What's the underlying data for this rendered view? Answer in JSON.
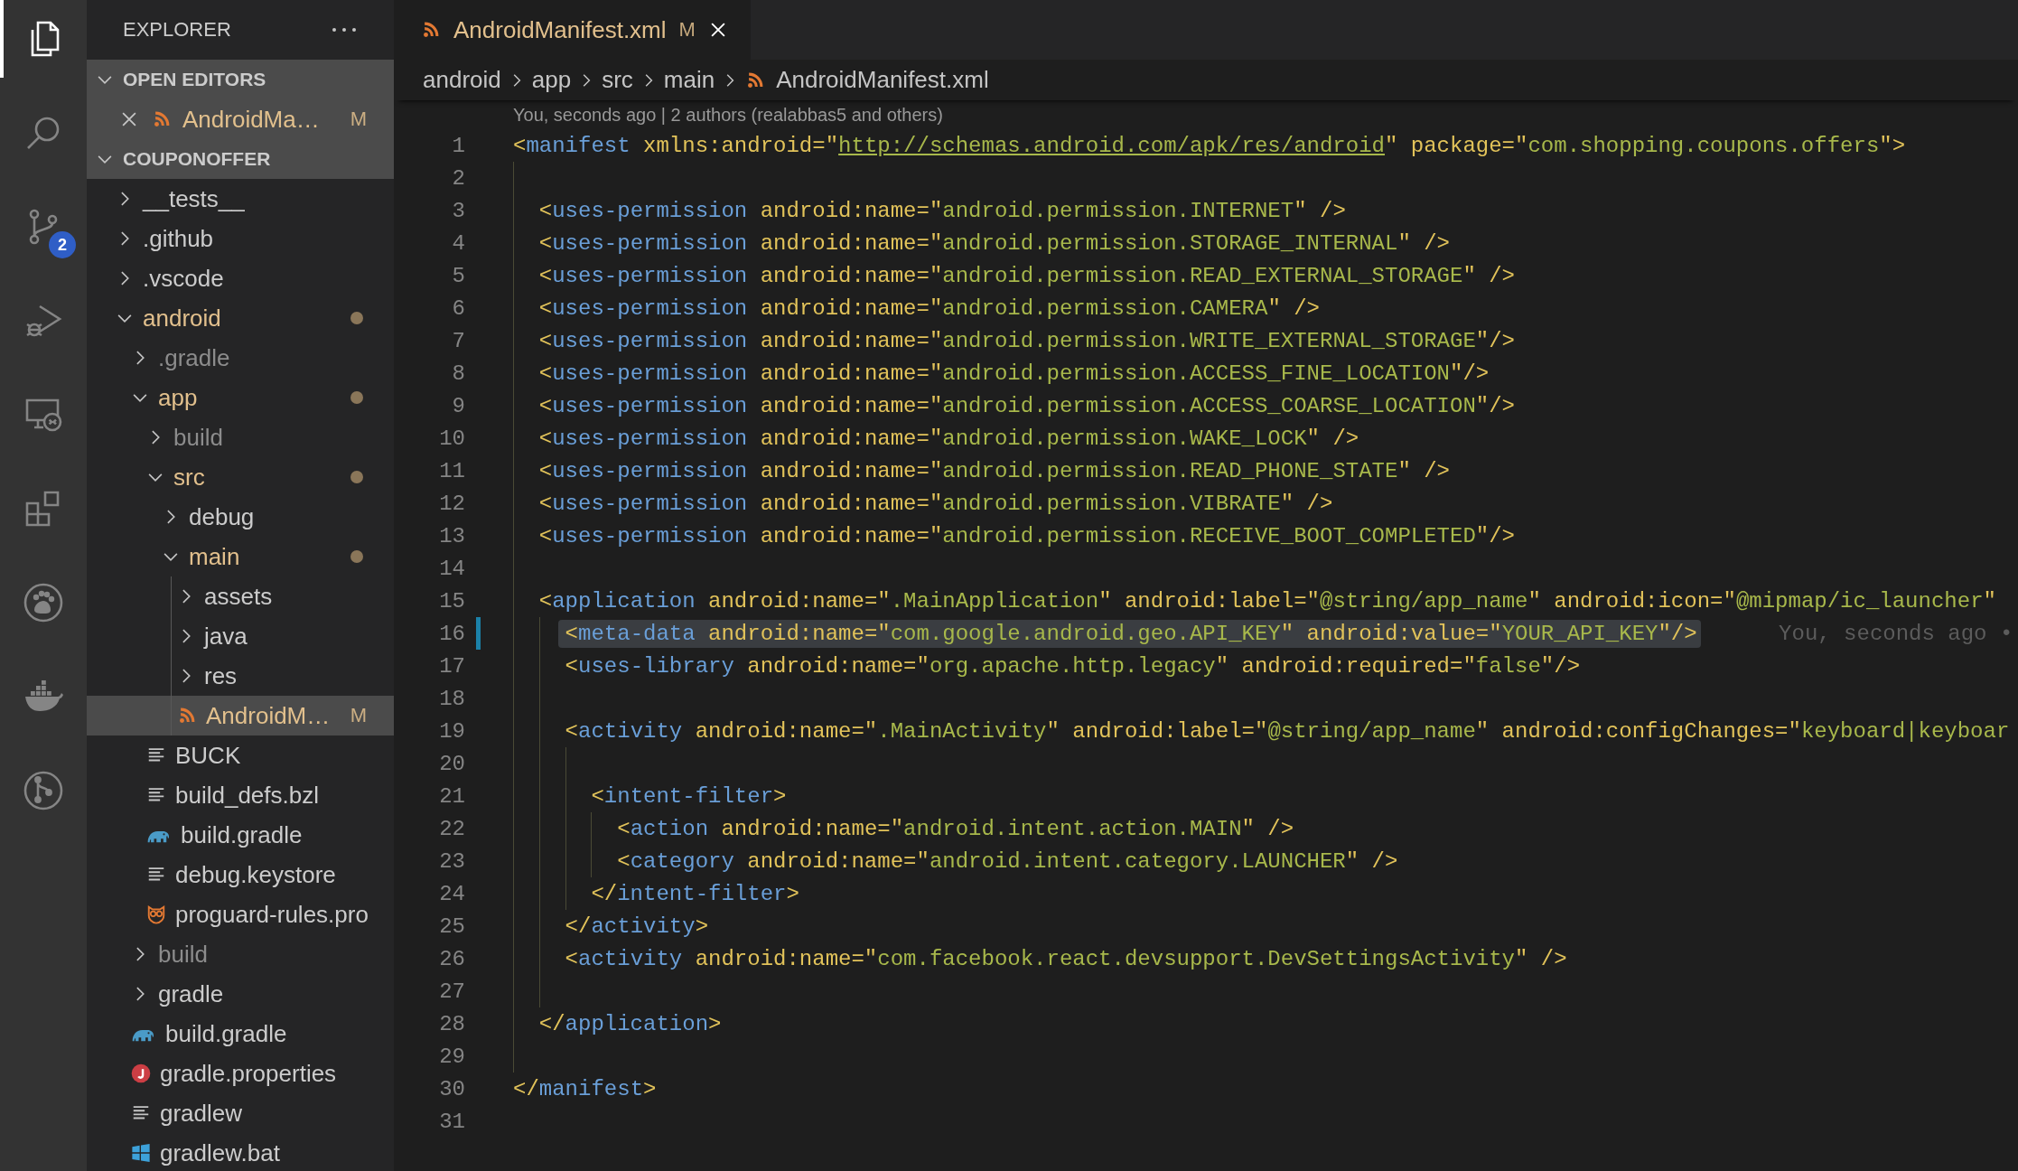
{
  "activity_bar": [
    {
      "kind": "files",
      "selected": true
    },
    {
      "kind": "search",
      "selected": false
    },
    {
      "kind": "source-control",
      "selected": false,
      "badge": "2"
    },
    {
      "kind": "run-debug",
      "selected": false
    },
    {
      "kind": "remote",
      "selected": false
    },
    {
      "kind": "extensions",
      "selected": false
    },
    {
      "kind": "paw",
      "selected": false
    },
    {
      "kind": "whale",
      "selected": false
    },
    {
      "kind": "git-graph",
      "selected": false
    }
  ],
  "sidebar": {
    "title": "EXPLORER",
    "open_editors": {
      "title": "OPEN EDITORS",
      "expanded": true,
      "items": [
        {
          "name": "AndroidMa…",
          "kind": "rss-file",
          "modified": true,
          "badge": "M"
        }
      ]
    },
    "project": {
      "title": "COUPONOFFER",
      "expanded": true,
      "tree": [
        {
          "name": "__tests__",
          "kind": "folder",
          "expanded": false,
          "modified": false,
          "ignored": false,
          "selected": false
        },
        {
          "name": ".github",
          "kind": "folder",
          "expanded": false,
          "modified": false,
          "ignored": false,
          "selected": false
        },
        {
          "name": ".vscode",
          "kind": "folder",
          "expanded": false,
          "modified": false,
          "ignored": false,
          "selected": false
        },
        {
          "name": "android",
          "kind": "folder",
          "expanded": true,
          "modified": true,
          "ignored": false,
          "selected": false,
          "children": [
            {
              "name": ".gradle",
              "kind": "folder",
              "expanded": false,
              "modified": false,
              "ignored": true,
              "selected": false
            },
            {
              "name": "app",
              "kind": "folder",
              "expanded": true,
              "modified": true,
              "ignored": false,
              "selected": false,
              "children": [
                {
                  "name": "build",
                  "kind": "folder",
                  "expanded": false,
                  "modified": false,
                  "ignored": true,
                  "selected": false
                },
                {
                  "name": "src",
                  "kind": "folder",
                  "expanded": true,
                  "modified": true,
                  "ignored": false,
                  "selected": false,
                  "children": [
                    {
                      "name": "debug",
                      "kind": "folder",
                      "expanded": false,
                      "modified": false,
                      "ignored": false,
                      "selected": false
                    },
                    {
                      "name": "main",
                      "kind": "folder",
                      "expanded": true,
                      "modified": true,
                      "ignored": false,
                      "selected": false,
                      "children": [
                        {
                          "name": "assets",
                          "kind": "folder",
                          "expanded": false,
                          "modified": false,
                          "ignored": false,
                          "selected": false
                        },
                        {
                          "name": "java",
                          "kind": "folder",
                          "expanded": false,
                          "modified": false,
                          "ignored": false,
                          "selected": false
                        },
                        {
                          "name": "res",
                          "kind": "folder",
                          "expanded": false,
                          "modified": false,
                          "ignored": false,
                          "selected": false
                        },
                        {
                          "name": "AndroidM…",
                          "kind": "rss-file",
                          "modified": true,
                          "ignored": false,
                          "badge": "M",
                          "selected": true
                        }
                      ]
                    }
                  ]
                },
                {
                  "name": "BUCK",
                  "kind": "text-file",
                  "modified": false,
                  "ignored": false,
                  "selected": false
                },
                {
                  "name": "build_defs.bzl",
                  "kind": "text-file",
                  "modified": false,
                  "ignored": false,
                  "selected": false
                },
                {
                  "name": "build.gradle",
                  "kind": "gradle-file",
                  "modified": false,
                  "ignored": false,
                  "selected": false
                },
                {
                  "name": "debug.keystore",
                  "kind": "text-file",
                  "modified": false,
                  "ignored": false,
                  "selected": false
                },
                {
                  "name": "proguard-rules.pro",
                  "kind": "owl-file",
                  "modified": false,
                  "ignored": false,
                  "selected": false
                }
              ]
            },
            {
              "name": "build",
              "kind": "folder",
              "expanded": false,
              "modified": false,
              "ignored": true,
              "selected": false
            },
            {
              "name": "gradle",
              "kind": "folder",
              "expanded": false,
              "modified": false,
              "ignored": false,
              "selected": false
            },
            {
              "name": "build.gradle",
              "kind": "gradle-file",
              "modified": false,
              "ignored": false,
              "selected": false
            },
            {
              "name": "gradle.properties",
              "kind": "properties-file",
              "modified": false,
              "ignored": false,
              "selected": false
            },
            {
              "name": "gradlew",
              "kind": "text-file",
              "modified": false,
              "ignored": false,
              "selected": false
            },
            {
              "name": "gradlew.bat",
              "kind": "batch-file",
              "modified": false,
              "ignored": false,
              "selected": false
            }
          ]
        }
      ]
    }
  },
  "editor": {
    "tabs": [
      {
        "title": "AndroidManifest.xml",
        "kind": "rss-file",
        "modified": true,
        "badge": "M",
        "selected": true
      }
    ],
    "breadcrumbs": [
      {
        "text": "android",
        "kind": "folder"
      },
      {
        "text": "app",
        "kind": "folder"
      },
      {
        "text": "src",
        "kind": "folder"
      },
      {
        "text": "main",
        "kind": "folder"
      },
      {
        "text": "AndroidManifest.xml",
        "kind": "rss-file"
      }
    ],
    "codelens": "You, seconds ago | 2 authors (realabbas5 and others)",
    "lines": [
      {
        "number": "1",
        "tokens": [
          {
            "kind": "punct",
            "text": "<"
          },
          {
            "kind": "tag",
            "text": "manifest"
          },
          {
            "kind": "attr",
            "text": " xmlns:android"
          },
          {
            "kind": "punct",
            "text": "=\""
          },
          {
            "kind": "link",
            "text": "http://schemas.android.com/apk/res/android"
          },
          {
            "kind": "punct",
            "text": "\""
          },
          {
            "kind": "attr",
            "text": " package"
          },
          {
            "kind": "punct",
            "text": "=\""
          },
          {
            "kind": "string",
            "text": "com.shopping.coupons.offers"
          },
          {
            "kind": "punct",
            "text": "\">"
          }
        ]
      },
      {
        "number": "2"
      },
      {
        "number": "3",
        "tokens": [
          {
            "kind": "punct",
            "text": "  <"
          },
          {
            "kind": "tag",
            "text": "uses-permission"
          },
          {
            "kind": "attr",
            "text": " android:name"
          },
          {
            "kind": "punct",
            "text": "=\""
          },
          {
            "kind": "string",
            "text": "android.permission.INTERNET"
          },
          {
            "kind": "punct",
            "text": "\" />"
          }
        ]
      },
      {
        "number": "4",
        "tokens": [
          {
            "kind": "punct",
            "text": "  <"
          },
          {
            "kind": "tag",
            "text": "uses-permission"
          },
          {
            "kind": "attr",
            "text": " android:name"
          },
          {
            "kind": "punct",
            "text": "=\""
          },
          {
            "kind": "string",
            "text": "android.permission.STORAGE_INTERNAL"
          },
          {
            "kind": "punct",
            "text": "\" />"
          }
        ]
      },
      {
        "number": "5",
        "tokens": [
          {
            "kind": "punct",
            "text": "  <"
          },
          {
            "kind": "tag",
            "text": "uses-permission"
          },
          {
            "kind": "attr",
            "text": " android:name"
          },
          {
            "kind": "punct",
            "text": "=\""
          },
          {
            "kind": "string",
            "text": "android.permission.READ_EXTERNAL_STORAGE"
          },
          {
            "kind": "punct",
            "text": "\" />"
          }
        ]
      },
      {
        "number": "6",
        "tokens": [
          {
            "kind": "punct",
            "text": "  <"
          },
          {
            "kind": "tag",
            "text": "uses-permission"
          },
          {
            "kind": "attr",
            "text": " android:name"
          },
          {
            "kind": "punct",
            "text": "=\""
          },
          {
            "kind": "string",
            "text": "android.permission.CAMERA"
          },
          {
            "kind": "punct",
            "text": "\" />"
          }
        ]
      },
      {
        "number": "7",
        "tokens": [
          {
            "kind": "punct",
            "text": "  <"
          },
          {
            "kind": "tag",
            "text": "uses-permission"
          },
          {
            "kind": "attr",
            "text": " android:name"
          },
          {
            "kind": "punct",
            "text": "=\""
          },
          {
            "kind": "string",
            "text": "android.permission.WRITE_EXTERNAL_STORAGE"
          },
          {
            "kind": "punct",
            "text": "\"/>"
          }
        ]
      },
      {
        "number": "8",
        "tokens": [
          {
            "kind": "punct",
            "text": "  <"
          },
          {
            "kind": "tag",
            "text": "uses-permission"
          },
          {
            "kind": "attr",
            "text": " android:name"
          },
          {
            "kind": "punct",
            "text": "=\""
          },
          {
            "kind": "string",
            "text": "android.permission.ACCESS_FINE_LOCATION"
          },
          {
            "kind": "punct",
            "text": "\"/>"
          }
        ]
      },
      {
        "number": "9",
        "tokens": [
          {
            "kind": "punct",
            "text": "  <"
          },
          {
            "kind": "tag",
            "text": "uses-permission"
          },
          {
            "kind": "attr",
            "text": " android:name"
          },
          {
            "kind": "punct",
            "text": "=\""
          },
          {
            "kind": "string",
            "text": "android.permission.ACCESS_COARSE_LOCATION"
          },
          {
            "kind": "punct",
            "text": "\"/>"
          }
        ]
      },
      {
        "number": "10",
        "tokens": [
          {
            "kind": "punct",
            "text": "  <"
          },
          {
            "kind": "tag",
            "text": "uses-permission"
          },
          {
            "kind": "attr",
            "text": " android:name"
          },
          {
            "kind": "punct",
            "text": "=\""
          },
          {
            "kind": "string",
            "text": "android.permission.WAKE_LOCK"
          },
          {
            "kind": "punct",
            "text": "\" />"
          }
        ]
      },
      {
        "number": "11",
        "tokens": [
          {
            "kind": "punct",
            "text": "  <"
          },
          {
            "kind": "tag",
            "text": "uses-permission"
          },
          {
            "kind": "attr",
            "text": " android:name"
          },
          {
            "kind": "punct",
            "text": "=\""
          },
          {
            "kind": "string",
            "text": "android.permission.READ_PHONE_STATE"
          },
          {
            "kind": "punct",
            "text": "\" />"
          }
        ]
      },
      {
        "number": "12",
        "tokens": [
          {
            "kind": "punct",
            "text": "  <"
          },
          {
            "kind": "tag",
            "text": "uses-permission"
          },
          {
            "kind": "attr",
            "text": " android:name"
          },
          {
            "kind": "punct",
            "text": "=\""
          },
          {
            "kind": "string",
            "text": "android.permission.VIBRATE"
          },
          {
            "kind": "punct",
            "text": "\" />"
          }
        ]
      },
      {
        "number": "13",
        "tokens": [
          {
            "kind": "punct",
            "text": "  <"
          },
          {
            "kind": "tag",
            "text": "uses-permission"
          },
          {
            "kind": "attr",
            "text": " android:name"
          },
          {
            "kind": "punct",
            "text": "=\""
          },
          {
            "kind": "string",
            "text": "android.permission.RECEIVE_BOOT_COMPLETED"
          },
          {
            "kind": "punct",
            "text": "\"/>"
          }
        ]
      },
      {
        "number": "14"
      },
      {
        "number": "15",
        "tokens": [
          {
            "kind": "punct",
            "text": "  <"
          },
          {
            "kind": "tag",
            "text": "application"
          },
          {
            "kind": "attr",
            "text": " android:name"
          },
          {
            "kind": "punct",
            "text": "=\""
          },
          {
            "kind": "string",
            "text": ".MainApplication"
          },
          {
            "kind": "punct",
            "text": "\""
          },
          {
            "kind": "attr",
            "text": " android:label"
          },
          {
            "kind": "punct",
            "text": "=\""
          },
          {
            "kind": "string",
            "text": "@string/app_name"
          },
          {
            "kind": "punct",
            "text": "\""
          },
          {
            "kind": "attr",
            "text": " android:icon"
          },
          {
            "kind": "punct",
            "text": "=\""
          },
          {
            "kind": "string",
            "text": "@mipmap/ic_launcher"
          },
          {
            "kind": "punct",
            "text": "\""
          }
        ]
      },
      {
        "number": "16",
        "highlighted": true,
        "changed": true,
        "blame": "You, seconds ago •",
        "tokens": [
          {
            "kind": "punct",
            "text": "    <"
          },
          {
            "kind": "tag",
            "text": "meta-data"
          },
          {
            "kind": "attr",
            "text": " android:name"
          },
          {
            "kind": "punct",
            "text": "=\""
          },
          {
            "kind": "string",
            "text": "com.google.android.geo.API_KEY"
          },
          {
            "kind": "punct",
            "text": "\""
          },
          {
            "kind": "attr",
            "text": " android:value"
          },
          {
            "kind": "punct",
            "text": "=\""
          },
          {
            "kind": "string",
            "text": "YOUR_API_KEY"
          },
          {
            "kind": "punct",
            "text": "\"/>"
          }
        ]
      },
      {
        "number": "17",
        "tokens": [
          {
            "kind": "punct",
            "text": "    <"
          },
          {
            "kind": "tag",
            "text": "uses-library"
          },
          {
            "kind": "attr",
            "text": " android:name"
          },
          {
            "kind": "punct",
            "text": "=\""
          },
          {
            "kind": "string",
            "text": "org.apache.http.legacy"
          },
          {
            "kind": "punct",
            "text": "\""
          },
          {
            "kind": "attr",
            "text": " android:required"
          },
          {
            "kind": "punct",
            "text": "=\""
          },
          {
            "kind": "string",
            "text": "false"
          },
          {
            "kind": "punct",
            "text": "\"/>"
          }
        ]
      },
      {
        "number": "18"
      },
      {
        "number": "19",
        "tokens": [
          {
            "kind": "punct",
            "text": "    <"
          },
          {
            "kind": "tag",
            "text": "activity"
          },
          {
            "kind": "attr",
            "text": " android:name"
          },
          {
            "kind": "punct",
            "text": "=\""
          },
          {
            "kind": "string",
            "text": ".MainActivity"
          },
          {
            "kind": "punct",
            "text": "\""
          },
          {
            "kind": "attr",
            "text": " android:label"
          },
          {
            "kind": "punct",
            "text": "=\""
          },
          {
            "kind": "string",
            "text": "@string/app_name"
          },
          {
            "kind": "punct",
            "text": "\""
          },
          {
            "kind": "attr",
            "text": " android:configChanges"
          },
          {
            "kind": "punct",
            "text": "=\""
          },
          {
            "kind": "string",
            "text": "keyboard|keyboar"
          }
        ]
      },
      {
        "number": "20"
      },
      {
        "number": "21",
        "tokens": [
          {
            "kind": "punct",
            "text": "      <"
          },
          {
            "kind": "tag",
            "text": "intent-filter"
          },
          {
            "kind": "punct",
            "text": ">"
          }
        ]
      },
      {
        "number": "22",
        "tokens": [
          {
            "kind": "punct",
            "text": "        <"
          },
          {
            "kind": "tag",
            "text": "action"
          },
          {
            "kind": "attr",
            "text": " android:name"
          },
          {
            "kind": "punct",
            "text": "=\""
          },
          {
            "kind": "string",
            "text": "android.intent.action.MAIN"
          },
          {
            "kind": "punct",
            "text": "\" />"
          }
        ]
      },
      {
        "number": "23",
        "tokens": [
          {
            "kind": "punct",
            "text": "        <"
          },
          {
            "kind": "tag",
            "text": "category"
          },
          {
            "kind": "attr",
            "text": " android:name"
          },
          {
            "kind": "punct",
            "text": "=\""
          },
          {
            "kind": "string",
            "text": "android.intent.category.LAUNCHER"
          },
          {
            "kind": "punct",
            "text": "\" />"
          }
        ]
      },
      {
        "number": "24",
        "tokens": [
          {
            "kind": "punct",
            "text": "      </"
          },
          {
            "kind": "tag",
            "text": "intent-filter"
          },
          {
            "kind": "punct",
            "text": ">"
          }
        ]
      },
      {
        "number": "25",
        "tokens": [
          {
            "kind": "punct",
            "text": "    </"
          },
          {
            "kind": "tag",
            "text": "activity"
          },
          {
            "kind": "punct",
            "text": ">"
          }
        ]
      },
      {
        "number": "26",
        "tokens": [
          {
            "kind": "punct",
            "text": "    <"
          },
          {
            "kind": "tag",
            "text": "activity"
          },
          {
            "kind": "attr",
            "text": " android:name"
          },
          {
            "kind": "punct",
            "text": "=\""
          },
          {
            "kind": "string",
            "text": "com.facebook.react.devsupport.DevSettingsActivity"
          },
          {
            "kind": "punct",
            "text": "\" />"
          }
        ]
      },
      {
        "number": "27"
      },
      {
        "number": "28",
        "tokens": [
          {
            "kind": "punct",
            "text": "  </"
          },
          {
            "kind": "tag",
            "text": "application"
          },
          {
            "kind": "punct",
            "text": ">"
          }
        ]
      },
      {
        "number": "29"
      },
      {
        "number": "30",
        "tokens": [
          {
            "kind": "punct",
            "text": "</"
          },
          {
            "kind": "tag",
            "text": "manifest"
          },
          {
            "kind": "punct",
            "text": ">"
          }
        ]
      },
      {
        "number": "31"
      }
    ]
  }
}
